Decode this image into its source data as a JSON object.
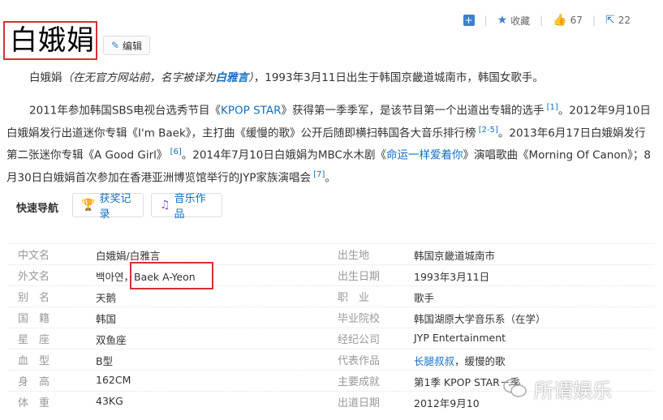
{
  "actions": {
    "add_label": "+",
    "favorite_label": "收藏",
    "like_count": "67",
    "share_count": "22"
  },
  "title": "白娥娟",
  "edit_label": "编辑",
  "intro": {
    "name": "白娥娟",
    "note_prefix": "（在无官方网站前，名字被译为",
    "note_name": "白雅言",
    "note_suffix": "）",
    "rest": "，1993年3月11日出生于韩国京畿道城南市，韩国女歌手。"
  },
  "bio": {
    "s1": "2011年参加韩国SBS电视台选秀节目《",
    "kpop": "KPOP STAR",
    "s2": "》获得第一季季军，是该节目第一个出道出专辑的选手",
    "ref1": " [1]",
    "s3": "。2012年9月10日白娥娟发行出道迷你专辑《I'm Baek》，主打曲《缓慢的歌》公开后随即横扫韩国各大音乐排行榜",
    "ref2": " [2-5]",
    "s4": "。2013年6月17日白娥娟发行第二张迷你专辑《A Good Girl》",
    "ref3": " [6]",
    "s5": "。2014年7月10日白娥娟为MBC水木剧《",
    "drama": "命运一样爱着你",
    "s6": "》演唱歌曲《Morning Of Canon》；8月30日白娥娟首次参加在香港亚洲博览馆举行的JYP家族演唱会",
    "ref4": " [7]",
    "s7": "。"
  },
  "quick_nav": {
    "label": "快速导航",
    "buttons": [
      "获奖记录",
      "音乐作品"
    ]
  },
  "info": {
    "left": [
      {
        "label": "中文名",
        "value": "白娥娟/白雅言"
      },
      {
        "label": "外文名",
        "value": "백아연，Baek A-Yeon"
      },
      {
        "label": "别　名",
        "value": "天鹅"
      },
      {
        "label": "国　籍",
        "value": "韩国"
      },
      {
        "label": "星　座",
        "value": "双鱼座"
      },
      {
        "label": "血　型",
        "value": "B型"
      },
      {
        "label": "身　高",
        "value": "162CM"
      },
      {
        "label": "体　重",
        "value": "43KG"
      }
    ],
    "right": [
      {
        "label": "出生地",
        "value": "韩国京畿道城南市"
      },
      {
        "label": "出生日期",
        "value": "1993年3月11日"
      },
      {
        "label": "职　业",
        "value": "歌手"
      },
      {
        "label": "毕业院校",
        "value": "韩国湖原大学音乐系（在学）"
      },
      {
        "label": "经纪公司",
        "value": "JYP Entertainment"
      },
      {
        "label": "代表作品",
        "value_link": "长腿叔叔",
        "value_rest": "，缓慢的歌"
      },
      {
        "label": "主要成就",
        "value": "第1季 KPOP STAR－季"
      },
      {
        "label": "出道日期",
        "value": "2012年9月10"
      }
    ]
  },
  "watermark": "所谓娱乐",
  "colors": {
    "link": "#136ec2",
    "highlight": "#d92f2f",
    "icon_blue": "#3d7fd0"
  }
}
